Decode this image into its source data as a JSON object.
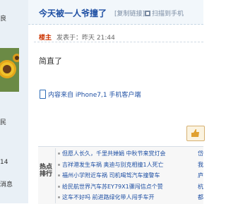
{
  "sidebar": {
    "top_label": "良",
    "labels": [
      "民",
      "14",
      "消息"
    ]
  },
  "thread": {
    "title": "今天被一人爷撞了",
    "copy_link": "[复制链接]",
    "mobile_scan": "扫描到手机"
  },
  "post": {
    "author_badge": "楼主",
    "meta": "发表于：昨天 21:44",
    "body": "简直了",
    "source_text": "内容来自 iPhone7,1 手机客户端"
  },
  "hot": {
    "label": "热点排行",
    "items": [
      "但愿人长久，千里共婵娟 中秋节来赏灯会",
      "吉祥港发生车祸 奥迪与别克相撞1人死亡",
      "福州小学附近车祸 司机喝驾汽车撞警车",
      "给民航世界汽车苏EY79X1骤闯信点个赞",
      "这车不好吗 前进路绿化带人闯手车开"
    ],
    "right_stub": [
      "岱",
      "我",
      "庐",
      "杭",
      "都"
    ]
  }
}
